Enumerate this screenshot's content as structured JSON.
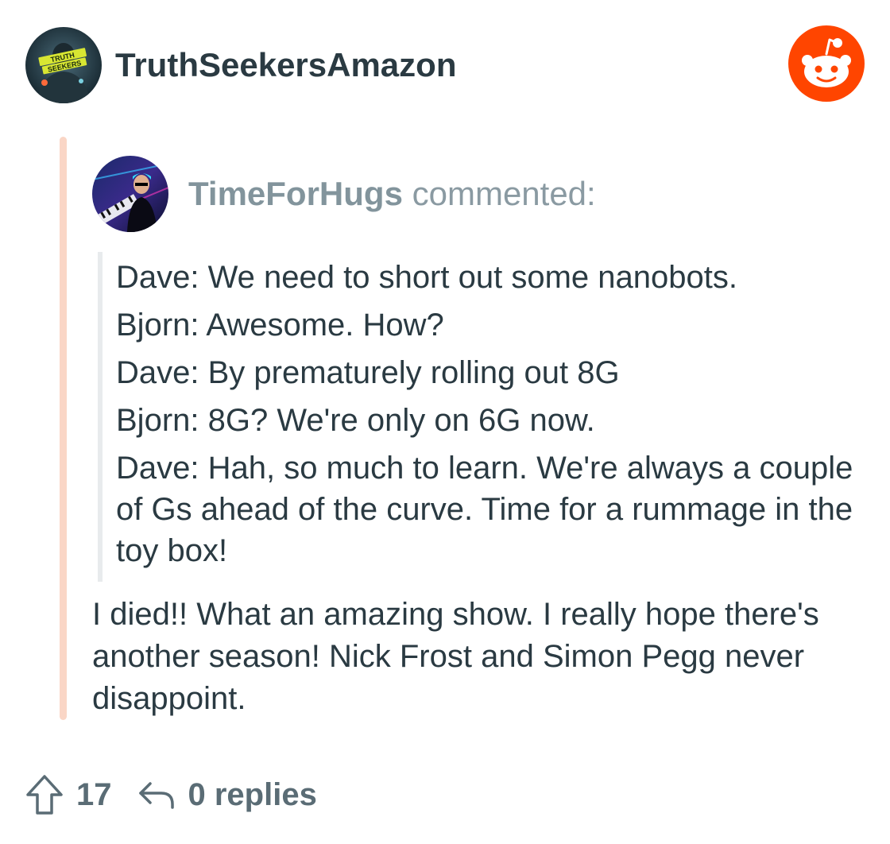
{
  "post": {
    "author": "TruthSeekersAmazon",
    "author_avatar_text": "TRUTH SEEKERS",
    "app_logo": "reddit-logo"
  },
  "parent_comment": {
    "author": "TimeForHugs",
    "action": "commented:",
    "quote_lines": [
      "Dave: We need to short out some nanobots.",
      "Bjorn: Awesome. How?",
      "Dave: By prematurely rolling out 8G",
      "Bjorn: 8G? We're only on 6G now.",
      "Dave: Hah, so much to learn. We're always a couple of Gs ahead of the curve. Time for a rummage in the toy box!"
    ]
  },
  "reply": {
    "body": "I died!! What an amazing show. I really hope there's another season! Nick Frost and Simon Pegg never disappoint."
  },
  "footer": {
    "upvotes": "17",
    "replies_label": "0 replies",
    "upvote_icon": "arrow-up-icon",
    "reply_icon": "reply-arrow-icon"
  },
  "colors": {
    "reddit_orange": "#ff4500",
    "thread_line": "#fad6c6",
    "text_dark": "#2a3a42",
    "text_muted": "#82949c"
  }
}
